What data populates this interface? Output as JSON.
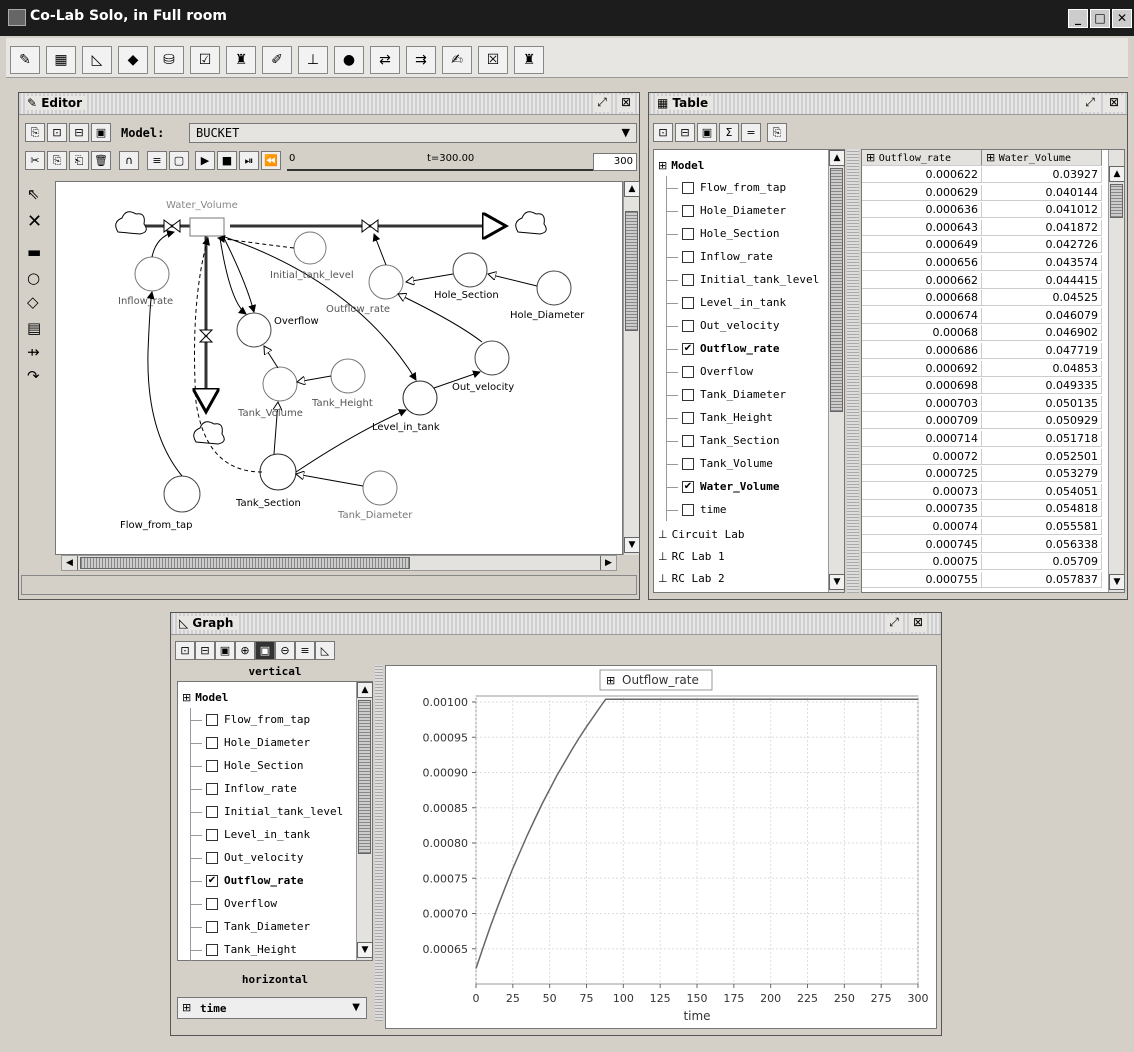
{
  "window": {
    "title": "Co-Lab Solo, in Full room"
  },
  "toolbar": {
    "icons": [
      "editor-icon",
      "table-icon",
      "graph-icon",
      "diamond-icon",
      "database-icon",
      "notepad-icon",
      "trash-icon",
      "stamp-icon",
      "circuit-icon",
      "globe-icon",
      "rc-lab-icon",
      "rc-lab-2-icon",
      "note-icon",
      "check-note-icon",
      "bin-icon"
    ]
  },
  "editor": {
    "title": "Editor",
    "model_label": "Model:",
    "model_name": "BUCKET",
    "slider_min": "0",
    "time_label": "t=300.00",
    "time_end": "300",
    "nodes": {
      "water_volume": "Water_Volume",
      "initial_tank_level": "Initial_tank_level",
      "inflow_rate": "Inflow_rate",
      "outflow_rate": "Outflow_rate",
      "hole_section": "Hole_Section",
      "hole_diameter": "Hole_Diameter",
      "overflow": "Overflow",
      "out_velocity": "Out_velocity",
      "tank_height": "Tank_Height",
      "tank_volume": "Tank_Volume",
      "level_in_tank": "Level_in_tank",
      "flow_from_tap": "Flow_from_tap",
      "tank_section": "Tank_Section",
      "tank_diameter": "Tank_Diameter"
    }
  },
  "table_panel": {
    "title": "Table",
    "tree_root": "Model",
    "tree_items": [
      {
        "label": "Flow_from_tap",
        "checked": false
      },
      {
        "label": "Hole_Diameter",
        "checked": false
      },
      {
        "label": "Hole_Section",
        "checked": false
      },
      {
        "label": "Inflow_rate",
        "checked": false
      },
      {
        "label": "Initial_tank_level",
        "checked": false
      },
      {
        "label": "Level_in_tank",
        "checked": false
      },
      {
        "label": "Out_velocity",
        "checked": false
      },
      {
        "label": "Outflow_rate",
        "checked": true
      },
      {
        "label": "Overflow",
        "checked": false
      },
      {
        "label": "Tank_Diameter",
        "checked": false
      },
      {
        "label": "Tank_Height",
        "checked": false
      },
      {
        "label": "Tank_Section",
        "checked": false
      },
      {
        "label": "Tank_Volume",
        "checked": false
      },
      {
        "label": "Water_Volume",
        "checked": true
      },
      {
        "label": "time",
        "checked": false
      }
    ],
    "extra_roots": [
      "Circuit Lab",
      "RC Lab 1",
      "RC Lab 2"
    ],
    "columns": [
      "Outflow_rate",
      "Water_Volume"
    ],
    "rows": [
      [
        "0.000622",
        "0.03927"
      ],
      [
        "0.000629",
        "0.040144"
      ],
      [
        "0.000636",
        "0.041012"
      ],
      [
        "0.000643",
        "0.041872"
      ],
      [
        "0.000649",
        "0.042726"
      ],
      [
        "0.000656",
        "0.043574"
      ],
      [
        "0.000662",
        "0.044415"
      ],
      [
        "0.000668",
        "0.04525"
      ],
      [
        "0.000674",
        "0.046079"
      ],
      [
        "0.00068",
        "0.046902"
      ],
      [
        "0.000686",
        "0.047719"
      ],
      [
        "0.000692",
        "0.04853"
      ],
      [
        "0.000698",
        "0.049335"
      ],
      [
        "0.000703",
        "0.050135"
      ],
      [
        "0.000709",
        "0.050929"
      ],
      [
        "0.000714",
        "0.051718"
      ],
      [
        "0.00072",
        "0.052501"
      ],
      [
        "0.000725",
        "0.053279"
      ],
      [
        "0.00073",
        "0.054051"
      ],
      [
        "0.000735",
        "0.054818"
      ],
      [
        "0.00074",
        "0.055581"
      ],
      [
        "0.000745",
        "0.056338"
      ],
      [
        "0.00075",
        "0.05709"
      ],
      [
        "0.000755",
        "0.057837"
      ]
    ]
  },
  "graph_panel": {
    "title": "Graph",
    "vertical_label": "vertical",
    "horizontal_label": "horizontal",
    "tree_root": "Model",
    "tree_items": [
      {
        "label": "Flow_from_tap",
        "checked": false
      },
      {
        "label": "Hole_Diameter",
        "checked": false
      },
      {
        "label": "Hole_Section",
        "checked": false
      },
      {
        "label": "Inflow_rate",
        "checked": false
      },
      {
        "label": "Initial_tank_level",
        "checked": false
      },
      {
        "label": "Level_in_tank",
        "checked": false
      },
      {
        "label": "Out_velocity",
        "checked": false
      },
      {
        "label": "Outflow_rate",
        "checked": true
      },
      {
        "label": "Overflow",
        "checked": false
      },
      {
        "label": "Tank_Diameter",
        "checked": false
      },
      {
        "label": "Tank_Height",
        "checked": false
      }
    ],
    "horizontal_selected": "time"
  },
  "chart_data": {
    "type": "line",
    "title": "",
    "legend": "Outflow_rate",
    "xlabel": "time",
    "ylabel": "",
    "xlim": [
      0,
      300
    ],
    "ylim": [
      0.0006,
      0.001
    ],
    "xticks": [
      "0",
      "25",
      "50",
      "75",
      "100",
      "125",
      "150",
      "175",
      "200",
      "225",
      "250",
      "275",
      "300"
    ],
    "yticks": [
      "0.00065",
      "0.00070",
      "0.00075",
      "0.00080",
      "0.00085",
      "0.00090",
      "0.00095",
      "0.00100"
    ],
    "grid": true,
    "series": [
      {
        "name": "Outflow_rate",
        "x": [
          0,
          5,
          10,
          15,
          20,
          25,
          30,
          35,
          40,
          45,
          50,
          55,
          60,
          65,
          70,
          75,
          80,
          85,
          88,
          90,
          100,
          150,
          200,
          250,
          300
        ],
        "y": [
          0.000622,
          0.000653,
          0.000683,
          0.000711,
          0.000738,
          0.000764,
          0.000788,
          0.000812,
          0.000834,
          0.000856,
          0.000876,
          0.000896,
          0.000914,
          0.000932,
          0.000949,
          0.000965,
          0.00098,
          0.000995,
          0.001004,
          0.001004,
          0.001004,
          0.001004,
          0.001004,
          0.001004,
          0.001004
        ]
      }
    ]
  }
}
